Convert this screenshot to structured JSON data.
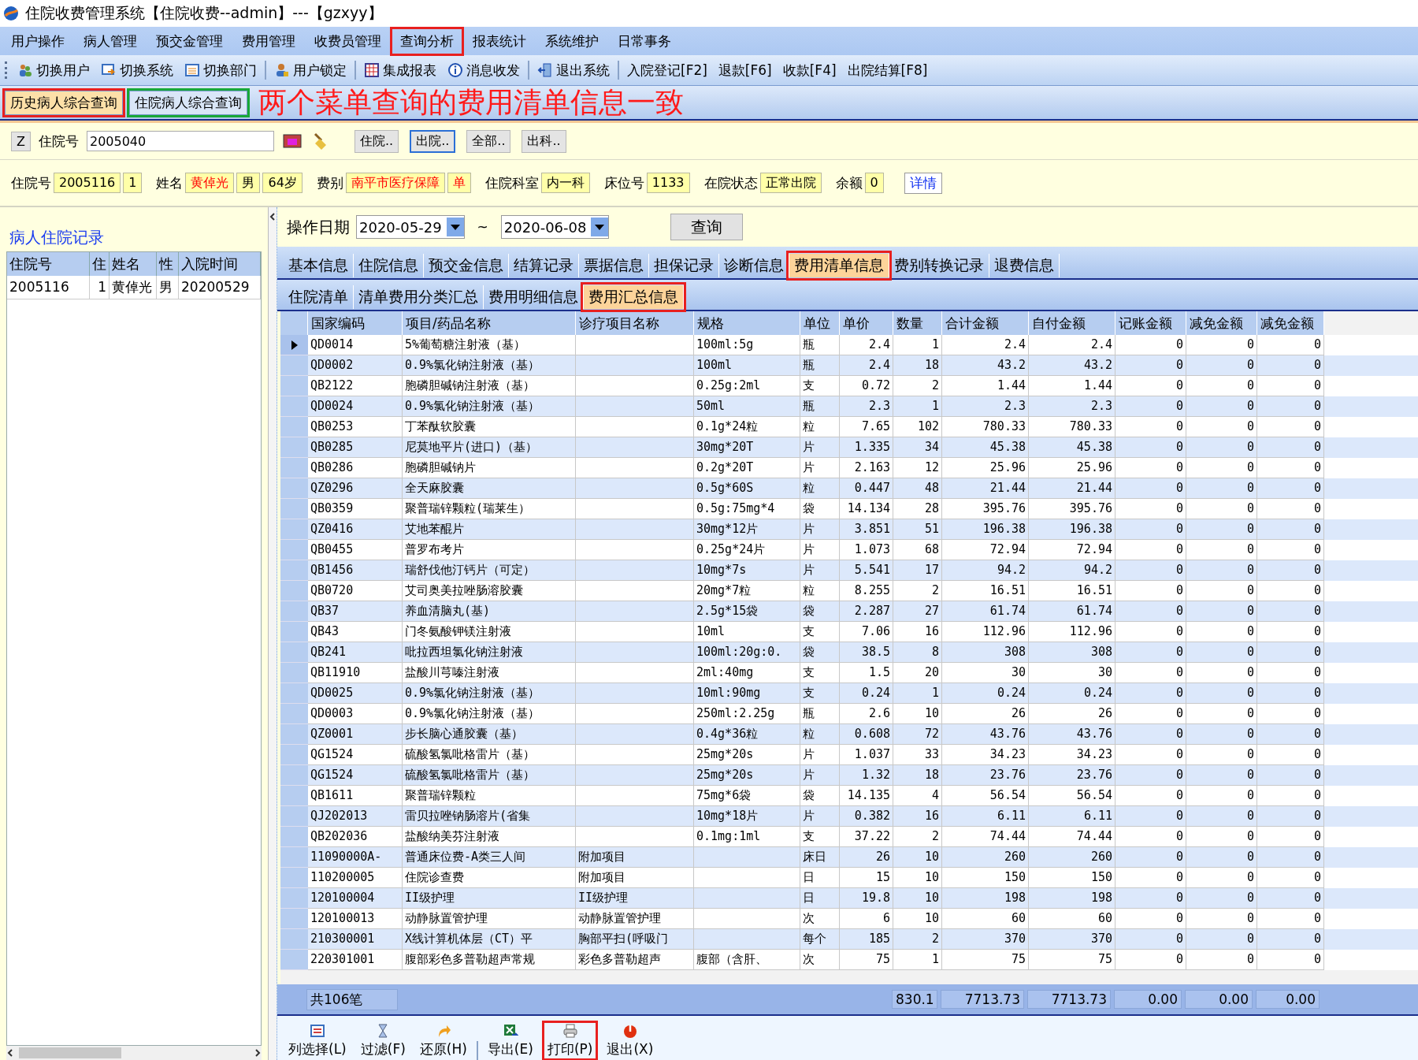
{
  "window": {
    "title": "住院收费管理系统【住院收费--admin】---【gzxyy】"
  },
  "menu": [
    {
      "label": "用户操作"
    },
    {
      "label": "病人管理"
    },
    {
      "label": "预交金管理"
    },
    {
      "label": "费用管理"
    },
    {
      "label": "收费员管理"
    },
    {
      "label": "查询分析",
      "color": "#e8201f"
    },
    {
      "label": "报表统计"
    },
    {
      "label": "系统维护"
    },
    {
      "label": "日常事务"
    }
  ],
  "toolbar": [
    {
      "label": "切换用户",
      "kind": "icon"
    },
    {
      "label": "切换系统",
      "kind": "icon"
    },
    {
      "label": "切换部门",
      "kind": "icon",
      "sep_after": true
    },
    {
      "label": "用户锁定",
      "kind": "icon",
      "sep_after": true
    },
    {
      "label": "集成报表",
      "kind": "icon"
    },
    {
      "label": "消息收发",
      "kind": "icon",
      "sep_after": true
    },
    {
      "label": "退出系统",
      "kind": "icon",
      "sep_after": true
    },
    {
      "label": "入院登记[F2]",
      "kind": "text"
    },
    {
      "label": "退款[F6]",
      "kind": "text"
    },
    {
      "label": "收款[F4]",
      "kind": "text"
    },
    {
      "label": "出院结算[F8]",
      "kind": "text"
    }
  ],
  "query_tabs": [
    {
      "label": "历史病人综合查询",
      "selected": true,
      "color": "#e8201f"
    },
    {
      "label": "住院病人综合查询",
      "selected": false,
      "color": "#18a838"
    }
  ],
  "annotation": "两个菜单查询的费用清单信息一致",
  "search": {
    "z_button": "Z",
    "label": "住院号",
    "value": "2005040",
    "buttons": [
      {
        "label": "住院..",
        "focused": false
      },
      {
        "label": "出院..",
        "focused": true
      },
      {
        "label": "全部..",
        "focused": false
      },
      {
        "label": "出科..",
        "focused": false
      }
    ]
  },
  "patient": [
    {
      "label": "住院号",
      "values": [
        {
          "text": "2005116",
          "alert": false
        },
        {
          "text": "1",
          "alert": false
        }
      ]
    },
    {
      "label": "姓名",
      "values": [
        {
          "text": "黄倬光",
          "alert": true
        },
        {
          "text": "男",
          "alert": false
        },
        {
          "text": "64岁",
          "alert": false
        }
      ]
    },
    {
      "label": "费别",
      "values": [
        {
          "text": "南平市医疗保障",
          "alert": true
        },
        {
          "text": "单",
          "alert": true
        }
      ]
    },
    {
      "label": "住院科室",
      "values": [
        {
          "text": "内一科",
          "alert": false
        }
      ]
    },
    {
      "label": "床位号",
      "values": [
        {
          "text": "1133",
          "alert": false
        }
      ]
    },
    {
      "label": "在院状态",
      "values": [
        {
          "text": "正常出院",
          "alert": false
        }
      ]
    },
    {
      "label": "余额",
      "values": [
        {
          "text": "0",
          "alert": false
        }
      ]
    }
  ],
  "detail_button": "详情",
  "history": {
    "title": "病人住院记录",
    "columns": [
      "住院号",
      "住",
      "姓名",
      "性",
      "入院时间"
    ],
    "rows": [
      {
        "cells": [
          "2005116",
          "1",
          "黄倬光",
          "男",
          "20200529"
        ]
      }
    ]
  },
  "date_filter": {
    "label": "操作日期",
    "from": "2020-05-29",
    "separator": "~",
    "to": "2020-06-08",
    "button": "查询"
  },
  "tabs": [
    {
      "label": "基本信息",
      "selected": false
    },
    {
      "label": "住院信息",
      "selected": false
    },
    {
      "label": "预交金信息",
      "selected": false
    },
    {
      "label": "结算记录",
      "selected": false
    },
    {
      "label": "票据信息",
      "selected": false
    },
    {
      "label": "担保记录",
      "selected": false
    },
    {
      "label": "诊断信息",
      "selected": false
    },
    {
      "label": "费用清单信息",
      "selected": true,
      "color": "#e8201f"
    },
    {
      "label": "费别转换记录",
      "selected": false
    },
    {
      "label": "退费信息",
      "selected": false
    }
  ],
  "subtabs": [
    {
      "label": "住院清单",
      "selected": false
    },
    {
      "label": "清单费用分类汇总",
      "selected": false
    },
    {
      "label": "费用明细信息",
      "selected": false
    },
    {
      "label": "费用汇总信息",
      "selected": true,
      "color": "#e8201f"
    }
  ],
  "table": {
    "columns": [
      "国家编码",
      "项目/药品名称",
      "诊疗项目名称",
      "规格",
      "单位",
      "单价",
      "数量",
      "合计金额",
      "自付金额",
      "记账金额",
      "减免金额",
      "减免金额"
    ],
    "rows": [
      {
        "selected": true,
        "cells": [
          "QD0014",
          "5%葡萄糖注射液（基）",
          "",
          "100ml:5g",
          "瓶",
          "2.4",
          "1",
          "2.4",
          "2.4",
          "0",
          "0",
          "0"
        ]
      },
      {
        "selected": false,
        "cells": [
          "QD0002",
          "0.9%氯化钠注射液（基）",
          "",
          "100ml",
          "瓶",
          "2.4",
          "18",
          "43.2",
          "43.2",
          "0",
          "0",
          "0"
        ]
      },
      {
        "selected": false,
        "cells": [
          "QB2122",
          "胞磷胆碱钠注射液（基）",
          "",
          "0.25g:2ml",
          "支",
          "0.72",
          "2",
          "1.44",
          "1.44",
          "0",
          "0",
          "0"
        ]
      },
      {
        "selected": false,
        "cells": [
          "QD0024",
          "0.9%氯化钠注射液（基）",
          "",
          "50ml",
          "瓶",
          "2.3",
          "1",
          "2.3",
          "2.3",
          "0",
          "0",
          "0"
        ]
      },
      {
        "selected": false,
        "cells": [
          "QB0253",
          "丁苯酞软胶囊",
          "",
          "0.1g*24粒",
          "粒",
          "7.65",
          "102",
          "780.33",
          "780.33",
          "0",
          "0",
          "0"
        ]
      },
      {
        "selected": false,
        "cells": [
          "QB0285",
          "尼莫地平片(进口)（基）",
          "",
          "30mg*20T",
          "片",
          "1.335",
          "34",
          "45.38",
          "45.38",
          "0",
          "0",
          "0"
        ]
      },
      {
        "selected": false,
        "cells": [
          "QB0286",
          "胞磷胆碱钠片",
          "",
          "0.2g*20T",
          "片",
          "2.163",
          "12",
          "25.96",
          "25.96",
          "0",
          "0",
          "0"
        ]
      },
      {
        "selected": false,
        "cells": [
          "QZ0296",
          "全天麻胶囊",
          "",
          "0.5g*60S",
          "粒",
          "0.447",
          "48",
          "21.44",
          "21.44",
          "0",
          "0",
          "0"
        ]
      },
      {
        "selected": false,
        "cells": [
          "QB0359",
          "聚普瑞锌颗粒(瑞莱生）",
          "",
          "0.5g:75mg*4",
          "袋",
          "14.134",
          "28",
          "395.76",
          "395.76",
          "0",
          "0",
          "0"
        ]
      },
      {
        "selected": false,
        "cells": [
          "QZ0416",
          "艾地苯醌片",
          "",
          "30mg*12片",
          "片",
          "3.851",
          "51",
          "196.38",
          "196.38",
          "0",
          "0",
          "0"
        ]
      },
      {
        "selected": false,
        "cells": [
          "QB0455",
          "普罗布考片",
          "",
          "0.25g*24片",
          "片",
          "1.073",
          "68",
          "72.94",
          "72.94",
          "0",
          "0",
          "0"
        ]
      },
      {
        "selected": false,
        "cells": [
          "QB1456",
          "瑞舒伐他汀钙片（可定）",
          "",
          "10mg*7s",
          "片",
          "5.541",
          "17",
          "94.2",
          "94.2",
          "0",
          "0",
          "0"
        ]
      },
      {
        "selected": false,
        "cells": [
          "QB0720",
          "艾司奥美拉唑肠溶胶囊",
          "",
          "20mg*7粒",
          "粒",
          "8.255",
          "2",
          "16.51",
          "16.51",
          "0",
          "0",
          "0"
        ]
      },
      {
        "selected": false,
        "cells": [
          "QB37",
          "养血清脑丸(基)",
          "",
          "2.5g*15袋",
          "袋",
          "2.287",
          "27",
          "61.74",
          "61.74",
          "0",
          "0",
          "0"
        ]
      },
      {
        "selected": false,
        "cells": [
          "QB43",
          "门冬氨酸钾镁注射液",
          "",
          "10ml",
          "支",
          "7.06",
          "16",
          "112.96",
          "112.96",
          "0",
          "0",
          "0"
        ]
      },
      {
        "selected": false,
        "cells": [
          "QB241",
          "吡拉西坦氯化钠注射液",
          "",
          "100ml:20g:0.",
          "袋",
          "38.5",
          "8",
          "308",
          "308",
          "0",
          "0",
          "0"
        ]
      },
      {
        "selected": false,
        "cells": [
          "QB11910",
          "盐酸川芎嗪注射液",
          "",
          "2ml:40mg",
          "支",
          "1.5",
          "20",
          "30",
          "30",
          "0",
          "0",
          "0"
        ]
      },
      {
        "selected": false,
        "cells": [
          "QD0025",
          "0.9%氯化钠注射液（基）",
          "",
          "10ml:90mg",
          "支",
          "0.24",
          "1",
          "0.24",
          "0.24",
          "0",
          "0",
          "0"
        ]
      },
      {
        "selected": false,
        "cells": [
          "QD0003",
          "0.9%氯化钠注射液（基）",
          "",
          "250ml:2.25g",
          "瓶",
          "2.6",
          "10",
          "26",
          "26",
          "0",
          "0",
          "0"
        ]
      },
      {
        "selected": false,
        "cells": [
          "QZ0001",
          "步长脑心通胶囊（基）",
          "",
          "0.4g*36粒",
          "粒",
          "0.608",
          "72",
          "43.76",
          "43.76",
          "0",
          "0",
          "0"
        ]
      },
      {
        "selected": false,
        "cells": [
          "QG1524",
          "硫酸氢氯吡格雷片（基）",
          "",
          "25mg*20s",
          "片",
          "1.037",
          "33",
          "34.23",
          "34.23",
          "0",
          "0",
          "0"
        ]
      },
      {
        "selected": false,
        "cells": [
          "QG1524",
          "硫酸氢氯吡格雷片（基）",
          "",
          "25mg*20s",
          "片",
          "1.32",
          "18",
          "23.76",
          "23.76",
          "0",
          "0",
          "0"
        ]
      },
      {
        "selected": false,
        "cells": [
          "QB1611",
          "聚普瑞锌颗粒",
          "",
          "75mg*6袋",
          "袋",
          "14.135",
          "4",
          "56.54",
          "56.54",
          "0",
          "0",
          "0"
        ]
      },
      {
        "selected": false,
        "cells": [
          "QJ202013",
          "雷贝拉唑钠肠溶片(省集",
          "",
          "10mg*18片",
          "片",
          "0.382",
          "16",
          "6.11",
          "6.11",
          "0",
          "0",
          "0"
        ]
      },
      {
        "selected": false,
        "cells": [
          "QB202036",
          "盐酸纳美芬注射液",
          "",
          "0.1mg:1ml",
          "支",
          "37.22",
          "2",
          "74.44",
          "74.44",
          "0",
          "0",
          "0"
        ]
      },
      {
        "selected": false,
        "cells": [
          "11090000A-",
          "普通床位费-A类三人间",
          "附加项目",
          "",
          "床日",
          "26",
          "10",
          "260",
          "260",
          "0",
          "0",
          "0"
        ]
      },
      {
        "selected": false,
        "cells": [
          "110200005",
          "住院诊查费",
          "附加项目",
          "",
          "日",
          "15",
          "10",
          "150",
          "150",
          "0",
          "0",
          "0"
        ]
      },
      {
        "selected": false,
        "cells": [
          "120100004",
          "II级护理",
          "II级护理",
          "",
          "日",
          "19.8",
          "10",
          "198",
          "198",
          "0",
          "0",
          "0"
        ]
      },
      {
        "selected": false,
        "cells": [
          "120100013",
          "动静脉置管护理",
          "动静脉置管护理",
          "",
          "次",
          "6",
          "10",
          "60",
          "60",
          "0",
          "0",
          "0"
        ]
      },
      {
        "selected": false,
        "cells": [
          "210300001",
          "X线计算机体层（CT）平",
          "胸部平扫(呼吸门",
          "",
          "每个",
          "185",
          "2",
          "370",
          "370",
          "0",
          "0",
          "0"
        ]
      },
      {
        "selected": false,
        "cells": [
          "220301001",
          "腹部彩色多普勒超声常规",
          "彩色多普勒超声",
          "腹部（含肝、",
          "次",
          "75",
          "1",
          "75",
          "75",
          "0",
          "0",
          "0"
        ]
      }
    ],
    "footer": {
      "count": "共106笔",
      "sums": [
        "830.1",
        "7713.73",
        "7713.73",
        "0.00",
        "0.00",
        "0.00"
      ]
    }
  },
  "actions": [
    {
      "label": "列选择(L)"
    },
    {
      "label": "过滤(F)"
    },
    {
      "label": "还原(H)",
      "sep_after": true
    },
    {
      "label": "导出(E)"
    },
    {
      "label": "打印(P)",
      "color": "#e8201f"
    },
    {
      "label": "退出(X)"
    }
  ]
}
